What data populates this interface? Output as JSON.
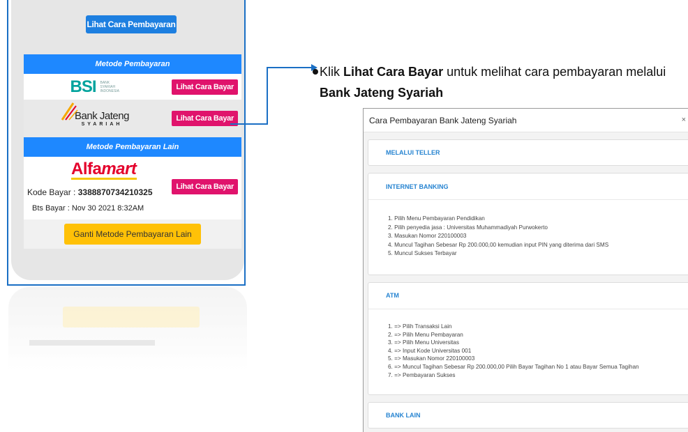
{
  "phone": {
    "top_button": "Lihat Cara Pembayaran",
    "section_metode": "Metode Pembayaran",
    "section_metode_lain": "Metode Pembayaran Lain",
    "bsi": {
      "mark": "BSI",
      "sub": "BANK SYARIAH INDONESIA",
      "button": "Lihat Cara Bayar"
    },
    "jateng": {
      "name": "Bank Jateng",
      "sub": "SYARIAH",
      "button": "Lihat Cara Bayar"
    },
    "alfamart": {
      "logo_a": "Alfa",
      "logo_b": "mart",
      "kode_label": "Kode Bayar : ",
      "kode_value": "3388870734210325",
      "bts_label": "Bts Bayar : Nov 30 2021 8:32AM",
      "button": "Lihat Cara Bayar"
    },
    "ganti_button": "Ganti Metode Pembayaran Lain"
  },
  "instruction": {
    "part1": "Klik ",
    "bold1": "Lihat Cara Bayar",
    "part2": " untuk melihat cara pembayaran melalui ",
    "bold2": "Bank Jateng Syariah"
  },
  "modal": {
    "title": "Cara Pembayaran Bank Jateng Syariah",
    "close": "×",
    "sections": [
      {
        "title": "MELALUI TELLER",
        "steps": []
      },
      {
        "title": "INTERNET BANKING",
        "steps": [
          "1. Pilih Menu Pembayaran Pendidikan",
          "2. Pilih penyedia jasa : Universitas Muhammadiyah Purwokerto",
          "3. Masukan Nomor 220100003",
          "4. Muncul Tagihan Sebesar Rp 200.000,00 kemudian input PIN yang diterima dari SMS",
          "5. Muncul Sukses Terbayar"
        ]
      },
      {
        "title": "ATM",
        "steps": [
          "1. => Pilih Transaksi Lain",
          "2. => Pilih Menu Pembayaran",
          "3. => Pilih Menu Universitas",
          "4. => Input Kode Universitas 001",
          "5. => Masukan Nomor 220100003",
          "6. => Muncul Tagihan Sebesar Rp 200.000,00 Pilih Bayar Tagihan No 1 atau Bayar Semua Tagihan",
          "7. => Pembayaran Sukses"
        ]
      },
      {
        "title": "BANK LAIN",
        "steps": []
      }
    ]
  },
  "colors": {
    "primary_blue": "#1e88ff",
    "pink_button": "#e0136c",
    "yellow_button": "#ffc107",
    "link_blue": "#2784d1"
  }
}
